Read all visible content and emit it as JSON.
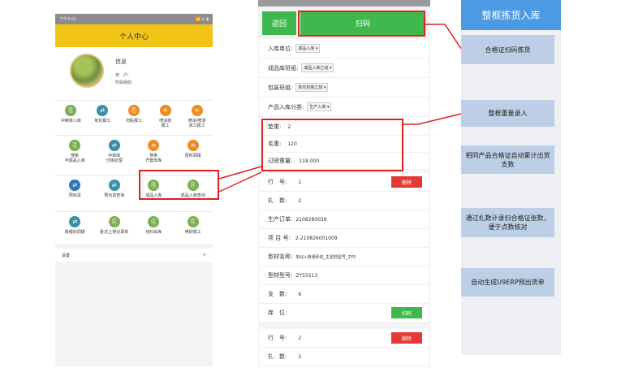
{
  "left_phone": {
    "status_time": "下午4:01",
    "status_right": "📶 ◎ ▮",
    "header_title": "个人中心",
    "profile": {
      "title": "信息",
      "user_label": "用　户:",
      "user_value": "",
      "org_label": "所属组织:",
      "org_value": ""
    },
    "grid1": [
      {
        "icon": "⎘",
        "label": "中转库入库",
        "color": "#7cae52"
      },
      {
        "icon": "⇄",
        "label": "氧化报工",
        "color": "#3b8fa8"
      },
      {
        "icon": "⎘",
        "label": "扫码报工",
        "color": "#ef8b24"
      },
      {
        "icon": "≋",
        "label": "喷涂前\n报工",
        "color": "#ef8b24"
      },
      {
        "icon": "≋",
        "label": "喷涂/喷漆\n完工报工",
        "color": "#ef8b24"
      }
    ],
    "grid2": [
      {
        "icon": "⎘",
        "label": "穿条\n半成品入库",
        "color": "#7cae52"
      },
      {
        "icon": "⇄",
        "label": "中转库\n分拣处理",
        "color": "#3b8fa8"
      },
      {
        "icon": "≋",
        "label": "穿条\n齐套出库",
        "color": "#ef8b24"
      },
      {
        "icon": "≋",
        "label": "原料调拨",
        "color": "#ef8b24"
      }
    ],
    "grid3": [
      {
        "icon": "⇄",
        "label": "预出货",
        "color": "#2f76b8"
      },
      {
        "icon": "⇄",
        "label": "预出货查询",
        "color": "#3b8fa8"
      },
      {
        "icon": "⎘",
        "label": "成品入库",
        "color": "#7cae52"
      },
      {
        "icon": "⎘",
        "label": "成品入库查询",
        "color": "#7cae52"
      }
    ],
    "grid4": [
      {
        "icon": "⇄",
        "label": "跨组织调拨",
        "color": "#3b8fa8"
      },
      {
        "icon": "⎘",
        "label": "卧式上排记录单",
        "color": "#7cae52"
      },
      {
        "icon": "⎘",
        "label": "坯料出库",
        "color": "#7cae52"
      },
      {
        "icon": "⎘",
        "label": "喷砂报工",
        "color": "#7cae52"
      }
    ],
    "settings_label": "设置",
    "settings_chevron": ">"
  },
  "right_phone": {
    "back_label": "返回",
    "scan_label": "扫码",
    "form": [
      {
        "label": "入库单位:",
        "value": "成品入库"
      },
      {
        "label": "成品库班组:",
        "value": "成品入库乙班"
      },
      {
        "label": "包装班组:",
        "value": "氧化包装乙班"
      },
      {
        "label": "产品入库分类:",
        "value": "生产入库"
      }
    ],
    "weights": [
      {
        "label": "垫重:",
        "value": "2"
      },
      {
        "label": "毛重:",
        "value": "120"
      },
      {
        "label": "过磅重量:",
        "value": "118.000"
      }
    ],
    "details": {
      "row_no_label": "行　号:",
      "row_no_value": "1",
      "delete_label": "删除",
      "bundle_label": "扎　数:",
      "bundle_value": "2",
      "order_label": "生产订单:",
      "order_value": "2108280039",
      "project_label": "项 目 号:",
      "project_value": "2-210826001009",
      "profile_name_label": "型材名称:",
      "profile_name_value": "氧化+普通砂纹_主型材型号_ZYS",
      "profile_model_label": "型材型号:",
      "profile_model_value": "ZY55513",
      "count_label": "支　数:",
      "count_value": "6",
      "location_label": "库　位:",
      "scan_small_label": "扫码",
      "row2_no_label": "行　号:",
      "row2_no_value": "2",
      "delete2_label": "删除",
      "bundle2_label": "扎　数:",
      "bundle2_value": "2"
    }
  },
  "sidebar": {
    "header": "整框拣货入库",
    "notes": [
      "合格证扫码拣货",
      "整框重量录入",
      "相同产品合格证自动累计出货支数",
      "通过扎数计录扫合格证张数，便于点数核对",
      "自动生成U9ERP预出货单"
    ]
  },
  "colors": {
    "accent_green": "#3fb94d",
    "header_yellow": "#f2c418",
    "highlight_red": "#e02020",
    "sidebar_blue": "#4d9ae4",
    "note_blue": "#bccfe6"
  }
}
